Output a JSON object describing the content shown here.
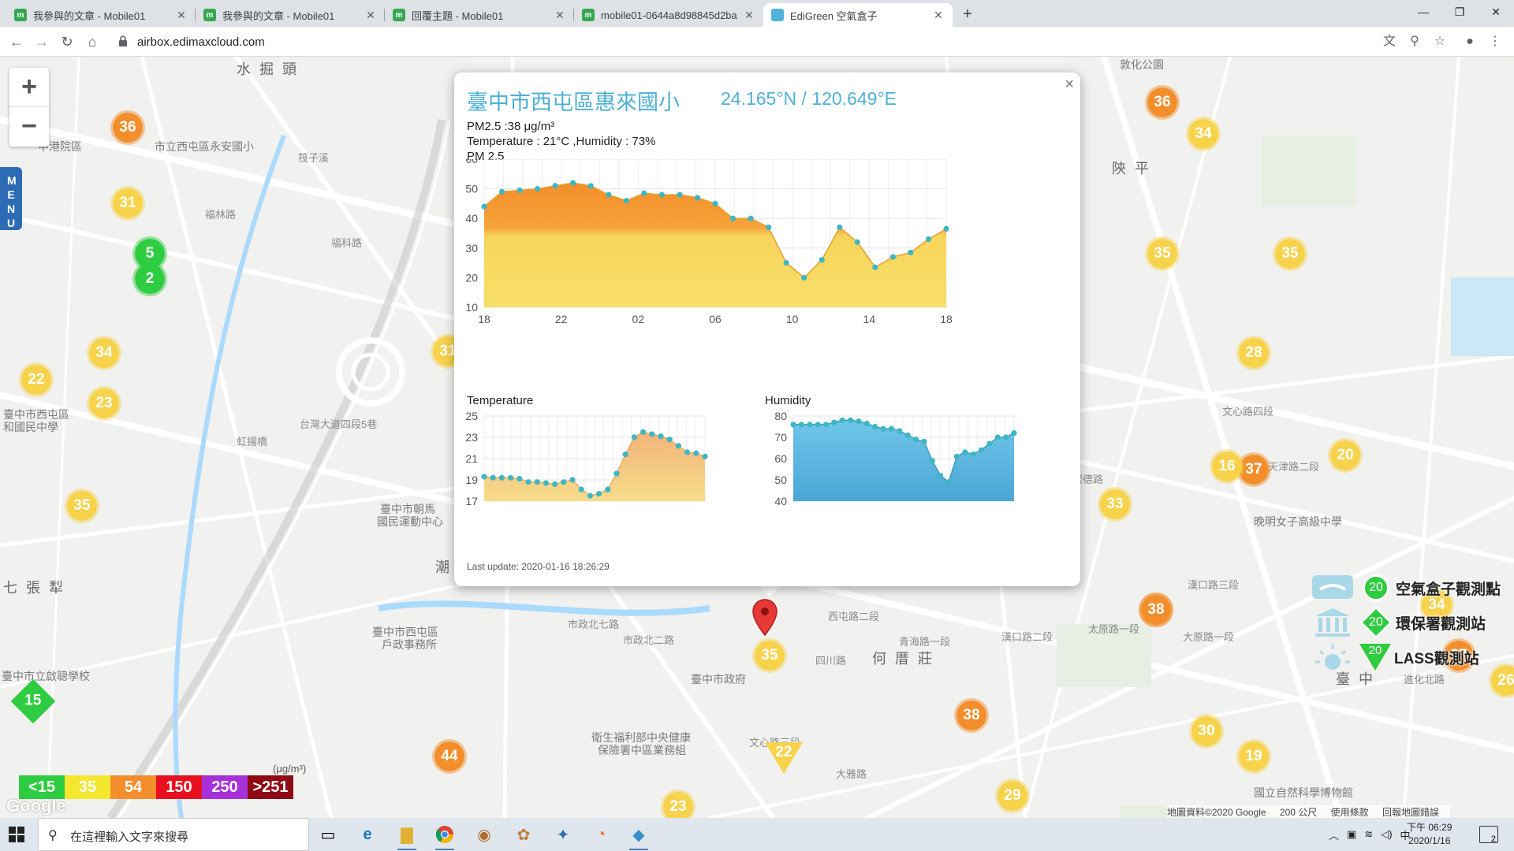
{
  "browser": {
    "tabs": [
      {
        "title": "我參與的文章 - Mobile01"
      },
      {
        "title": "我參與的文章 - Mobile01"
      },
      {
        "title": "回覆主題 - Mobile01"
      },
      {
        "title": "mobile01-0644a8d98845d2ba"
      },
      {
        "title": "EdiGreen 空氣盒子"
      }
    ],
    "url": "airbox.edimaxcloud.com"
  },
  "map": {
    "labels": [
      "水 掘 頭",
      "市立西屯區永安國小",
      "中港院區",
      "福林路",
      "福科路",
      "筏子溪",
      "臺中市西屯區",
      "和國民中學",
      "虹揚橋",
      "台灣大道四段5巷",
      "臺中市朝馬",
      "國民運動中心",
      "七 張 犁",
      "臺中市立啟聰學校",
      "臺中市西屯區",
      "戶政事務所",
      "市政北七路",
      "市政北二路",
      "臺中市政府",
      "衛生福利部中央健康",
      "保險署中區業務組",
      "文心路三段",
      "何 厝 莊",
      "西屯路二段",
      "四川路",
      "青海路一段",
      "漢口路二段",
      "太原路一段",
      "大原路一段",
      "文心路四段",
      "漢口路三段",
      "陝 平",
      "敦化公園",
      "臺 中",
      "進化北路",
      "國立自然科學博物館",
      "晚明女子高級中學",
      "崇德路",
      "天津路二段",
      "潮",
      "大雅路"
    ],
    "zoom_in": "+",
    "zoom_out": "−",
    "menu": "MENU",
    "markers": [
      {
        "v": "36",
        "c": "orange"
      },
      {
        "v": "31",
        "c": "yellow"
      },
      {
        "v": "5",
        "c": "green"
      },
      {
        "v": "2",
        "c": "green"
      },
      {
        "v": "34",
        "c": "yellow"
      },
      {
        "v": "22",
        "c": "yellow"
      },
      {
        "v": "23",
        "c": "yellow"
      },
      {
        "v": "35",
        "c": "yellow"
      },
      {
        "v": "15",
        "c": "diamond"
      },
      {
        "v": "44",
        "c": "orange"
      },
      {
        "v": "23",
        "c": "yellow"
      },
      {
        "v": "22",
        "c": "tri"
      },
      {
        "v": "35",
        "c": "yellow"
      },
      {
        "v": "38",
        "c": "orange"
      },
      {
        "v": "38",
        "c": "orange"
      },
      {
        "v": "29",
        "c": "yellow"
      },
      {
        "v": "36",
        "c": "orange"
      },
      {
        "v": "34",
        "c": "yellow"
      },
      {
        "v": "35",
        "c": "yellow"
      },
      {
        "v": "35",
        "c": "yellow"
      },
      {
        "v": "28",
        "c": "yellow"
      },
      {
        "v": "37",
        "c": "orange"
      },
      {
        "v": "16",
        "c": "yellow"
      },
      {
        "v": "20",
        "c": "yellow"
      },
      {
        "v": "33",
        "c": "yellow"
      },
      {
        "v": "38",
        "c": "orange"
      },
      {
        "v": "34",
        "c": "yellow"
      },
      {
        "v": "37",
        "c": "orange"
      },
      {
        "v": "30",
        "c": "yellow"
      },
      {
        "v": "19",
        "c": "yellow"
      },
      {
        "v": "26",
        "c": "yellow"
      },
      {
        "v": "31",
        "c": "yellow"
      }
    ],
    "legend": [
      {
        "label": "<15",
        "color": "#2ecc40"
      },
      {
        "label": "35",
        "color": "#f5e630"
      },
      {
        "label": "54",
        "color": "#f28e2b"
      },
      {
        "label": "150",
        "color": "#e8101e"
      },
      {
        "label": "250",
        "color": "#a830d8"
      },
      {
        "label": ">251",
        "color": "#8e0a14"
      }
    ],
    "legend_unit": "(μg/m³)",
    "google": "Google",
    "attribution": [
      "地圖資料©2020 Google",
      "200 公尺",
      "使用條款",
      "回報地圖錯誤"
    ],
    "station_types": [
      {
        "badge": "20",
        "label": "空氣盒子觀測點"
      },
      {
        "badge": "20",
        "label": "環保署觀測站"
      },
      {
        "badge": "20",
        "label": "LASS觀測站"
      }
    ]
  },
  "popup": {
    "title": "臺中市西屯區惠來國小",
    "coord": "24.165°N / 120.649°E",
    "pm_line": "PM2.5 :38 μg/m³",
    "temp_line": "Temperature : 21°C ,Humidity : 73%",
    "pm_chart_label": "PM 2.5",
    "temp_chart_label": "Temperature",
    "hum_chart_label": "Humidity",
    "last_update": "Last update: 2020-01-16 18:26:29",
    "close": "×"
  },
  "chart_data": [
    {
      "type": "area",
      "title": "PM 2.5",
      "x": [
        "18",
        "22",
        "02",
        "06",
        "10",
        "14",
        "18"
      ],
      "ylim": [
        10,
        60
      ],
      "yticks": [
        10,
        20,
        30,
        40,
        50,
        60
      ],
      "values": [
        44,
        49,
        49.5,
        50,
        51,
        52,
        51,
        48,
        46,
        48.5,
        48,
        48,
        47,
        45,
        40,
        40,
        37,
        25,
        20,
        26,
        37,
        32,
        23.5,
        27,
        28.5,
        33,
        36.5
      ]
    },
    {
      "type": "area",
      "title": "Temperature",
      "ylim": [
        17,
        25
      ],
      "yticks": [
        17,
        19,
        21,
        23,
        25
      ],
      "values": [
        19.3,
        19.2,
        19.2,
        19.2,
        19.1,
        18.8,
        18.8,
        18.7,
        18.6,
        18.8,
        19.0,
        18.1,
        17.5,
        17.7,
        18.1,
        19.6,
        21.4,
        23.0,
        23.5,
        23.3,
        23.1,
        22.8,
        22.2,
        21.6,
        21.5,
        21.2
      ]
    },
    {
      "type": "area",
      "title": "Humidity",
      "ylim": [
        40,
        80
      ],
      "yticks": [
        40,
        50,
        60,
        70,
        80
      ],
      "values": [
        76,
        76,
        76,
        76,
        76,
        77,
        78,
        78,
        77.5,
        76.5,
        75,
        74,
        74,
        73,
        71,
        69,
        68,
        59,
        52,
        49,
        61,
        63,
        62,
        64,
        67,
        70,
        70,
        72
      ]
    }
  ],
  "taskbar": {
    "search_placeholder": "在這裡輸入文字來搜尋",
    "tray_lang": "中",
    "time": "下午 06:29",
    "date": "2020/1/16",
    "notif_count": "2"
  }
}
